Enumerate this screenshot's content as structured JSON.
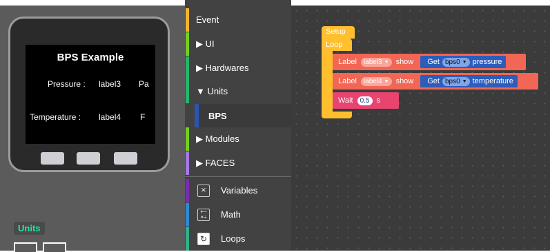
{
  "device": {
    "screen_title": "BPS Example",
    "line1": {
      "name": "Pressure :",
      "value": "label3",
      "unit": "Pa"
    },
    "line2": {
      "name": "Temperature :",
      "value": "label4",
      "unit": "F"
    },
    "units_badge": "Units"
  },
  "categories": {
    "items": [
      {
        "label": "Event",
        "color": "#f5b62e"
      },
      {
        "label": "▶ UI",
        "color": "#73d11e"
      },
      {
        "label": "▶ Hardwares",
        "color": "#27b56a"
      },
      {
        "label": "▼ Units",
        "color": "#27b56a"
      }
    ],
    "sub_item": {
      "label": "BPS",
      "color": "#2c55b2"
    },
    "items2": [
      {
        "label": "▶ Modules",
        "color": "#73d11e"
      },
      {
        "label": "▶ FACES",
        "color": "#a678e6"
      }
    ],
    "tools": [
      {
        "label": "Variables",
        "color": "#7a2db3",
        "icon": "variables-icon"
      },
      {
        "label": "Math",
        "color": "#2d8bd2",
        "icon": "math-icon"
      },
      {
        "label": "Loops",
        "color": "#2db38a",
        "icon": "loops-icon"
      }
    ]
  },
  "workspace": {
    "setup": "Setup",
    "loop": "Loop",
    "row1": {
      "label": "Label",
      "target": "label3",
      "show": "show",
      "get": "Get",
      "sensor": "bps0",
      "field": "pressure"
    },
    "row2": {
      "label": "Label",
      "target": "label4",
      "show": "show",
      "get": "Get",
      "sensor": "bps0",
      "field": "temperature"
    },
    "wait": {
      "label": "Wait",
      "value": "0.5",
      "unit": "s"
    }
  }
}
